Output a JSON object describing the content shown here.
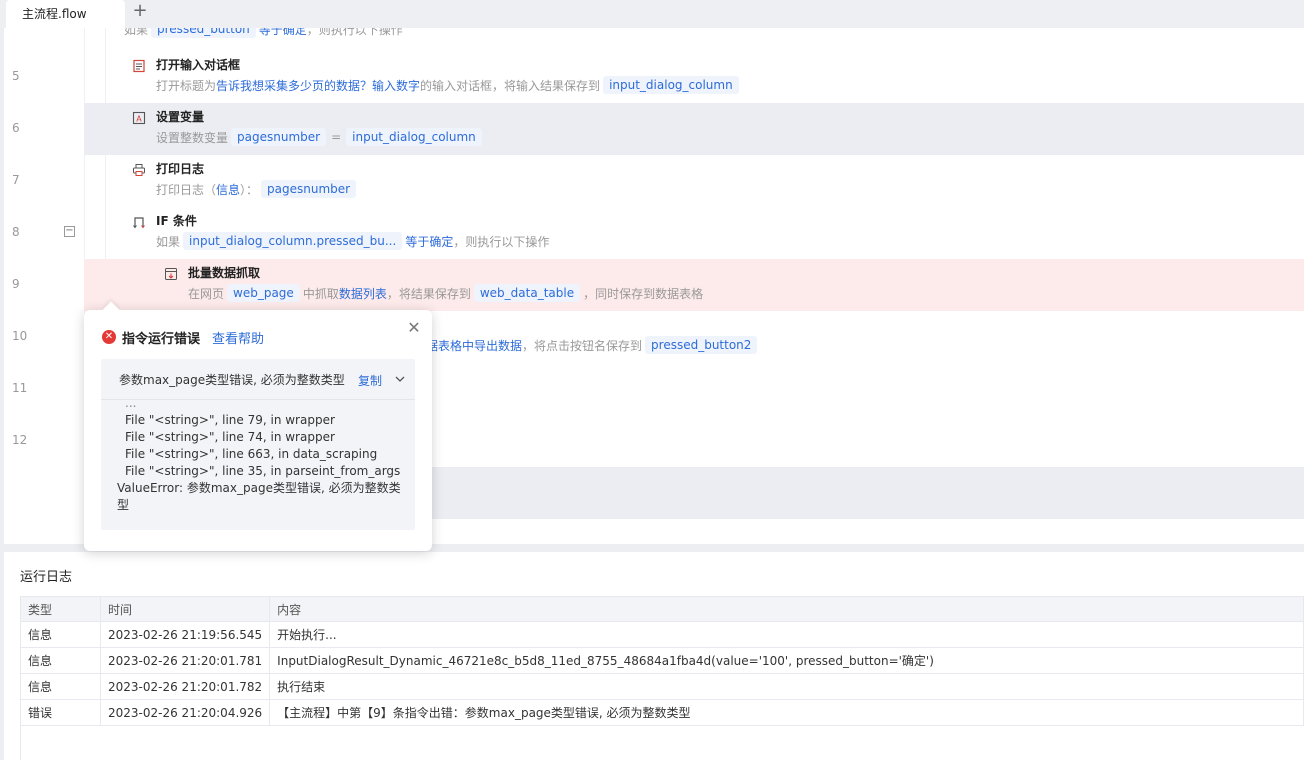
{
  "tabs": {
    "active_label": "主流程.flow",
    "add_label": "+"
  },
  "editor": {
    "topline": {
      "prefix": "如果",
      "var": "pressed_button",
      "cond": "等于确定",
      "suffix": "，则执行以下操作"
    },
    "rows": [
      {
        "num": "5",
        "title": "打开输入对话框",
        "icon": "dialog-icon",
        "desc": {
          "p1": "打开标题为",
          "h1": "告诉我想采集多少页的数据？",
          "h2": "输入数字",
          "p2": "的输入对话框，将输入结果保存到",
          "c1": "input_dialog_column"
        }
      },
      {
        "num": "6",
        "title": "设置变量",
        "icon": "variable-icon",
        "desc": {
          "p1": "设置整数变量",
          "c1": "pagesnumber",
          "p2": "=",
          "c2": "input_dialog_column"
        }
      },
      {
        "num": "7",
        "title": "打印日志",
        "icon": "printer-icon",
        "desc": {
          "p1": "打印日志（",
          "h1": "信息",
          "p2": "）：",
          "c1": "pagesnumber"
        }
      },
      {
        "num": "8",
        "title": "IF 条件",
        "icon": "if-branch-icon",
        "desc": {
          "p1": "如果",
          "c1": "input_dialog_column.pressed_bu...",
          "h1": "等于确定",
          "p2": "，则执行以下操作"
        }
      },
      {
        "num": "9",
        "title": "批量数据抓取",
        "icon": "scrape-icon",
        "desc": {
          "p1": "在网页",
          "c1": "web_page",
          "p2": "中抓取",
          "h1": "数据列表",
          "p3": "，将结果保存到",
          "c2": "web_data_table",
          "p4": "，同时保存到数据表格"
        }
      },
      {
        "num": "10",
        "desc": {
          "h1": "据表格中导出数据",
          "p1": "，将点击按钮名保存到",
          "c1": "pressed_button2"
        }
      },
      {
        "num": "11"
      },
      {
        "num": "12"
      }
    ],
    "collapse_symbol": "−"
  },
  "error_popup": {
    "title": "指令运行错误",
    "help_link": "查看帮助",
    "close_symbol": "✕",
    "error_symbol": "✕",
    "summary": "参数max_page类型错误, 必须为整数类型",
    "copy_label": "复制",
    "trace": [
      "...",
      "File \"<string>\", line 79, in wrapper",
      "File \"<string>\", line 74, in wrapper",
      "File \"<string>\", line 663, in data_scraping",
      "File \"<string>\", line 35, in parseint_from_args"
    ],
    "trace_error": "ValueError: 参数max_page类型错误, 必须为整数类型"
  },
  "log_panel": {
    "title": "运行日志",
    "columns": [
      "类型",
      "时间",
      "内容"
    ],
    "rows": [
      {
        "type": "信息",
        "time": "2023-02-26 21:19:56.545",
        "content": "开始执行..."
      },
      {
        "type": "信息",
        "time": "2023-02-26 21:20:01.781",
        "content": "InputDialogResult_Dynamic_46721e8c_b5d8_11ed_8755_48684a1fba4d(value='100', pressed_button='确定')"
      },
      {
        "type": "信息",
        "time": "2023-02-26 21:20:01.782",
        "content": "执行结束"
      },
      {
        "type": "错误",
        "time": "2023-02-26 21:20:04.926",
        "content": "【主流程】中第【9】条指令出错：参数max_page类型错误, 必须为整数类型"
      }
    ]
  },
  "colors": {
    "accent": "#2d6cd8",
    "error": "#e53935",
    "error_row_bg": "#fdeaea",
    "selected_row_bg": "#ecedf2"
  }
}
